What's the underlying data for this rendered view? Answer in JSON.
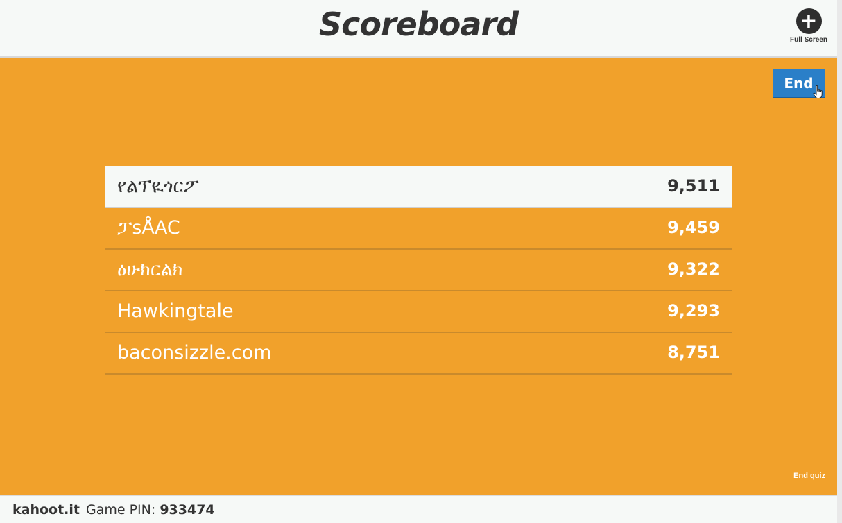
{
  "header": {
    "title": "Scoreboard",
    "fullscreen_label": "Full Screen",
    "fullscreen_icon": "plus-circle-icon"
  },
  "controls": {
    "end_label": "End",
    "end_quiz_label": "End quiz"
  },
  "scoreboard": {
    "rows": [
      {
        "name": "የልፕዪጎርፖ",
        "score": "9,511"
      },
      {
        "name": "ፓsÅAC",
        "score": "9,459"
      },
      {
        "name": "ዕሁክርልክ",
        "score": "9,322"
      },
      {
        "name": "Hawkingtale",
        "score": "9,293"
      },
      {
        "name": "baconsizzle.com",
        "score": "8,751"
      }
    ]
  },
  "footer": {
    "brand": "kahoot.it",
    "pin_label": "Game PIN:",
    "pin_value": "933474"
  },
  "colors": {
    "background": "#f1a12b",
    "end_button": "#2a7fc8",
    "header": "#f6f9f7",
    "text_dark": "#333333"
  }
}
